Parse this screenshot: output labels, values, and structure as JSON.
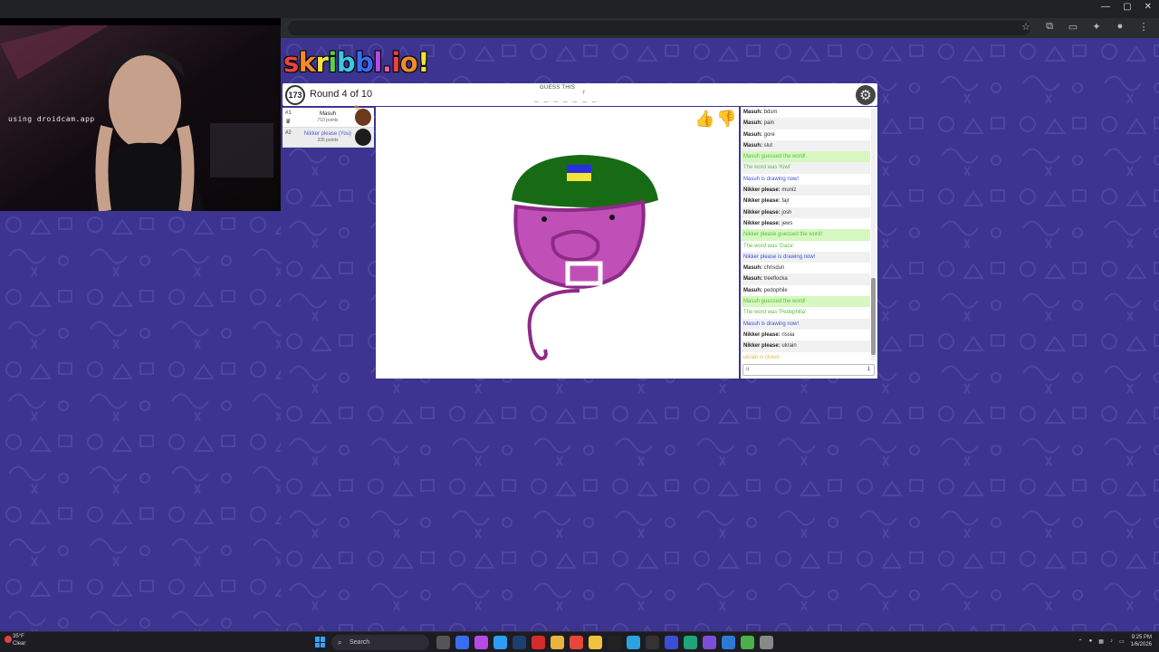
{
  "webcam": {
    "label": "using droidcam.app"
  },
  "logo": {
    "parts": [
      "s",
      "k",
      "r",
      "i",
      "b",
      "b",
      "l",
      ".",
      "i",
      "o",
      "!"
    ]
  },
  "header": {
    "timer": "173",
    "round": "Round 4 of 10",
    "guess_label": "GUESS THIS",
    "word_blanks": "_ _ _ _ _ _ _",
    "word_length": "7"
  },
  "players": [
    {
      "rank": "#1",
      "name": "Masuh",
      "points": "710 points"
    },
    {
      "rank": "#2",
      "name": "Nikker please (You)",
      "points": "335 points"
    }
  ],
  "chat": {
    "messages": [
      {
        "type": "normal",
        "user": "Masuh:",
        "text": "bdsm"
      },
      {
        "type": "normal",
        "user": "Masuh:",
        "text": "pain"
      },
      {
        "type": "normal",
        "user": "Masuh:",
        "text": "gore"
      },
      {
        "type": "normal",
        "user": "Masuh:",
        "text": "slut"
      },
      {
        "type": "guessed",
        "user": "",
        "text": "Masuh guessed the word!"
      },
      {
        "type": "reveal",
        "user": "",
        "text": "The word was 'Kiwi'"
      },
      {
        "type": "drawing",
        "user": "",
        "text": "Masuh is drawing now!"
      },
      {
        "type": "normal",
        "user": "Nikker please:",
        "text": "muniz"
      },
      {
        "type": "normal",
        "user": "Nikker please:",
        "text": "fajr"
      },
      {
        "type": "normal",
        "user": "Nikker please:",
        "text": "josh"
      },
      {
        "type": "normal",
        "user": "Nikker please:",
        "text": "jews"
      },
      {
        "type": "guessed",
        "user": "",
        "text": "Nikker please guessed the word!"
      },
      {
        "type": "reveal",
        "user": "",
        "text": "The word was 'Gaza'"
      },
      {
        "type": "drawing",
        "user": "",
        "text": "Nikker please is drawing now!"
      },
      {
        "type": "normal",
        "user": "Masuh:",
        "text": "chrisdun"
      },
      {
        "type": "normal",
        "user": "Masuh:",
        "text": "treeflocka"
      },
      {
        "type": "normal",
        "user": "Masuh:",
        "text": "pedophile"
      },
      {
        "type": "guessed",
        "user": "",
        "text": "Masuh guessed the word!"
      },
      {
        "type": "reveal",
        "user": "",
        "text": "The word was 'Pedophilia'"
      },
      {
        "type": "drawing",
        "user": "",
        "text": "Masuh is drawing now!"
      },
      {
        "type": "normal",
        "user": "Nikker please:",
        "text": "rissia"
      },
      {
        "type": "normal",
        "user": "Nikker please:",
        "text": "ukrain"
      },
      {
        "type": "closed",
        "user": "",
        "text": "ukrain is close!"
      }
    ],
    "input_value": "u",
    "input_count": "1"
  },
  "taskbar": {
    "weather_temp": "35°F",
    "weather_text": "Clear",
    "search_placeholder": "Search",
    "time": "9:25 PM",
    "date": "1/6/2026"
  },
  "colors": {
    "page_bg": "#3c3490",
    "guessed_green": "#56c23a",
    "drawing_blue": "#3a4fd8",
    "close_yellow": "#e8b341"
  }
}
